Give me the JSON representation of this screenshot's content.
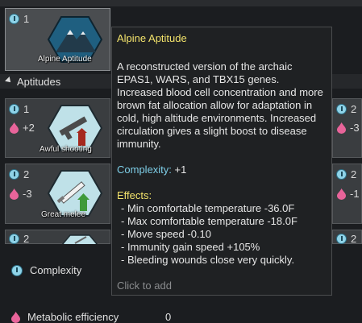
{
  "top_gene": {
    "complexity": "1",
    "label": "Alpine Aptitude"
  },
  "section": {
    "title": "Aptitudes"
  },
  "genes": [
    {
      "complexity": "1",
      "metabolic": "+2",
      "label": "Awful shooting"
    },
    {
      "complexity": "2",
      "metabolic": "-3",
      "label": "Great melee"
    },
    {
      "complexity": "2"
    }
  ],
  "right_column": [
    {
      "complexity": "2",
      "metabolic": "-3"
    },
    {
      "complexity": "2",
      "metabolic": "-1"
    },
    {
      "complexity": "2"
    }
  ],
  "tooltip": {
    "title": "Alpine Aptitude",
    "description": "A reconstructed version of the archaic EPAS1, WARS, and TBX15 genes. Increased blood cell concentration and more brown fat allocation allow for adaptation in cold, high altitude environments. Increased circulation gives a slight boost to disease immunity.",
    "complexity_label": "Complexity:",
    "complexity_value": " +1",
    "effects_label": "Effects:",
    "effects": [
      "- Min comfortable temperature -36.0F",
      "- Max comfortable temperature -18.0F",
      "- Move speed -0.10",
      "- Immunity gain speed +105%",
      "- Bleeding wounds close very quickly."
    ],
    "hint": "Click to add"
  },
  "summary": {
    "complexity_label": "Complexity",
    "metabolic_label": "Metabolic efficiency",
    "metabolic_value": "0"
  },
  "colors": {
    "complexity": "#8fd3e8",
    "metabolic": "#e8649a",
    "title": "#f3e36b"
  }
}
